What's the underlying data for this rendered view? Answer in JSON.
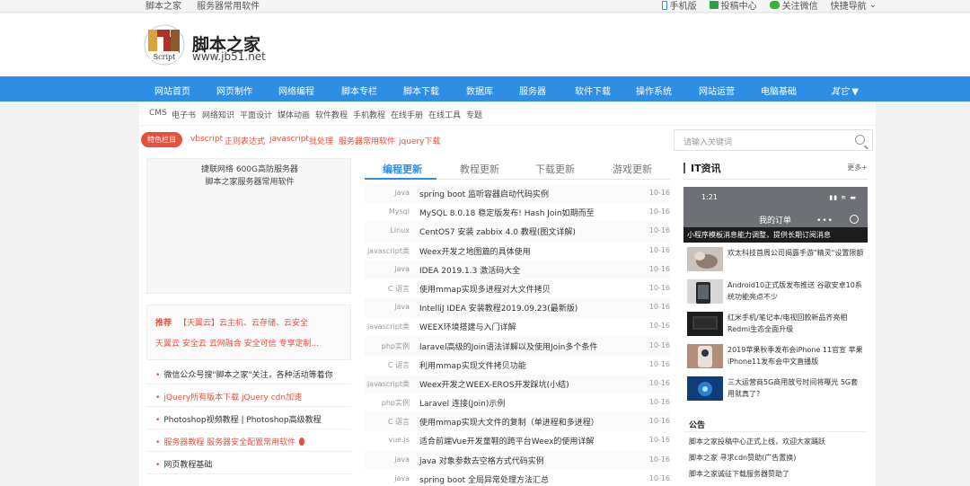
{
  "topbar": {
    "left": [
      "脚本之家",
      "服务器常用软件"
    ],
    "right": {
      "mobile": "手机版",
      "submit": "投稿中心",
      "wechat": "关注微信",
      "quicknav": "快捷导航"
    }
  },
  "header": {
    "logo_mark": "Script",
    "site_name": "脚本之家",
    "site_url": "www.jb51.net"
  },
  "nav": [
    "网站首页",
    "网页制作",
    "网络编程",
    "脚本专栏",
    "脚本下载",
    "数据库",
    "服务器",
    "软件下载",
    "操作系统",
    "网站运营",
    "电脑基础",
    "其它"
  ],
  "subnav": [
    "CMS",
    "电子书",
    "网络知识",
    "平面设计",
    "媒体动画",
    "软件教程",
    "手机教程",
    "在线手册",
    "在线工具",
    "专题"
  ],
  "hot": {
    "badge": "特色栏目",
    "links": [
      "vbscript",
      "正则表达式",
      "javascript",
      "批处理",
      "服务器常用软件",
      "jquery下载"
    ]
  },
  "search": {
    "placeholder": "请输入关键词"
  },
  "left": {
    "ad_line1": "捷联网络 600G高防服务器",
    "ad_line2": "脚本之家服务器常用软件",
    "rec_tag": "推荐",
    "rec_line1": "【天翼云】云主机、云存储、云安全",
    "rec_line2": "天翼云 安全云 云网融合 安全可信 专享定制...",
    "list": [
      "微信公众号搜\"脚本之家\"关注，各种活动等着你",
      "jQuery所有版本下载 jQuery cdn加速",
      "Photoshop视频教程 | Photoshop高级教程",
      "服务器教程  服务器安全配置常用软件",
      "网页教程基础"
    ]
  },
  "mid": {
    "tabs": [
      "编程更新",
      "教程更新",
      "下载更新",
      "游戏更新"
    ],
    "articles": [
      {
        "cat": "java",
        "title": "spring boot 监听容器启动代码实例",
        "date": "10-16"
      },
      {
        "cat": "Mysql",
        "title": "MySQL 8.0.18 稳定版发布! Hash Join如期而至",
        "date": "10-16"
      },
      {
        "cat": "Linux",
        "title": "CentOS7 安装 zabbix 4.0 教程(图文详解)",
        "date": "10-16"
      },
      {
        "cat": "javascript类",
        "title": "Weex开发之地图篇的具体使用",
        "date": "10-16"
      },
      {
        "cat": "java",
        "title": "IDEA 2019.1.3 激活码大全",
        "date": "10-16"
      },
      {
        "cat": "C 语言",
        "title": "使用mmap实现多进程对大文件拷贝",
        "date": "10-16"
      },
      {
        "cat": "java",
        "title": "IntelliJ IDEA 安装教程2019.09.23(最新版)",
        "date": "10-16"
      },
      {
        "cat": "javascript类",
        "title": "WEEX环境搭建与入门详解",
        "date": "10-16"
      },
      {
        "cat": "php实例",
        "title": "laravel高级的Join语法详解以及使用Join多个条件",
        "date": "10-16"
      },
      {
        "cat": "C 语言",
        "title": "利用mmap实现文件拷贝功能",
        "date": "10-16"
      },
      {
        "cat": "javascript类",
        "title": "Weex开发之WEEX-EROS开发踩坑(小结)",
        "date": "10-16"
      },
      {
        "cat": "php实例",
        "title": "Laravel 连接(Join)示例",
        "date": "10-16"
      },
      {
        "cat": "C 语言",
        "title": "使用mmap实现大文件的复制（单进程和多进程）",
        "date": "10-16"
      },
      {
        "cat": "vue.js",
        "title": "适合前端Vue开发童鞋的跨平台Weex的使用详解",
        "date": "10-16"
      },
      {
        "cat": "java",
        "title": "java 对象参数去空格方式代码实例",
        "date": "10-16"
      },
      {
        "cat": "java",
        "title": "spring boot 全局异常处理方法汇总",
        "date": "10-16"
      }
    ]
  },
  "right": {
    "title": "IT资讯",
    "more": "更多+",
    "phone": {
      "time": "1:21",
      "order": "我的订单",
      "caption": "小程序模板消息能力调整，提供长期订阅消息"
    },
    "news": [
      {
        "text": "欢太科技首周公司揭露手游\"精灵\"设置限额"
      },
      {
        "text": "Android10正式版发布推送 谷歌安卓10系统功能亮点不少"
      },
      {
        "text": "红米手机/笔记本/电视回款新品齐亮相Redmi生态全面升级"
      },
      {
        "text": "2019苹果秋季发布会iPhone 11官宣 苹果iPhone11发布会中文直播版"
      },
      {
        "text": "三大运营商5G商用放号时间将曝光 5G套用就真了?"
      }
    ],
    "announce_title": "公告",
    "announce": [
      "脚本之家投稿中心正式上线，欢迎大家踊跃",
      "脚本之家 寻求cdn赞助(广告置换)",
      "脚本之家诚征下载服务器赞助了"
    ]
  },
  "colors": {
    "accent": "#2d8ee3",
    "hot": "#e8503d"
  }
}
